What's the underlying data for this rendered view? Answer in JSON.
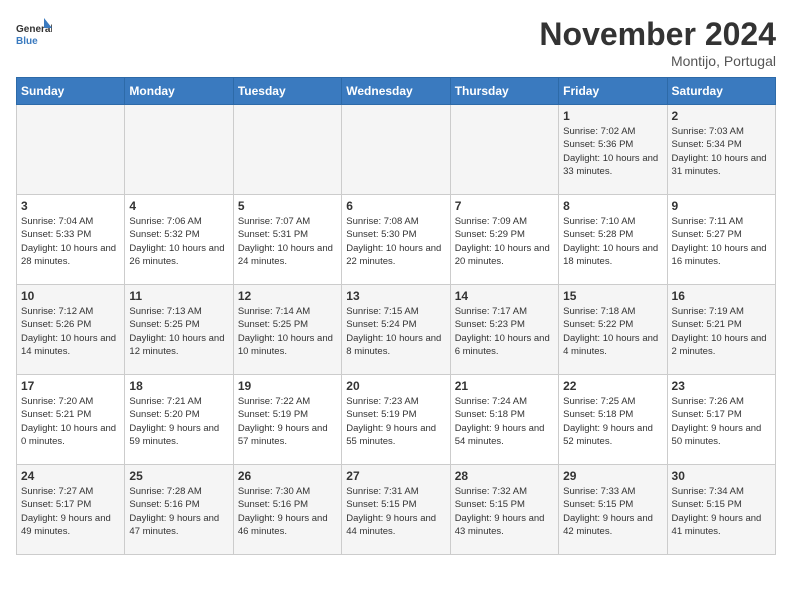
{
  "logo": {
    "line1": "General",
    "line2": "Blue"
  },
  "title": "November 2024",
  "subtitle": "Montijo, Portugal",
  "weekdays": [
    "Sunday",
    "Monday",
    "Tuesday",
    "Wednesday",
    "Thursday",
    "Friday",
    "Saturday"
  ],
  "weeks": [
    [
      {
        "day": "",
        "info": ""
      },
      {
        "day": "",
        "info": ""
      },
      {
        "day": "",
        "info": ""
      },
      {
        "day": "",
        "info": ""
      },
      {
        "day": "",
        "info": ""
      },
      {
        "day": "1",
        "info": "Sunrise: 7:02 AM\nSunset: 5:36 PM\nDaylight: 10 hours\nand 33 minutes."
      },
      {
        "day": "2",
        "info": "Sunrise: 7:03 AM\nSunset: 5:34 PM\nDaylight: 10 hours\nand 31 minutes."
      }
    ],
    [
      {
        "day": "3",
        "info": "Sunrise: 7:04 AM\nSunset: 5:33 PM\nDaylight: 10 hours\nand 28 minutes."
      },
      {
        "day": "4",
        "info": "Sunrise: 7:06 AM\nSunset: 5:32 PM\nDaylight: 10 hours\nand 26 minutes."
      },
      {
        "day": "5",
        "info": "Sunrise: 7:07 AM\nSunset: 5:31 PM\nDaylight: 10 hours\nand 24 minutes."
      },
      {
        "day": "6",
        "info": "Sunrise: 7:08 AM\nSunset: 5:30 PM\nDaylight: 10 hours\nand 22 minutes."
      },
      {
        "day": "7",
        "info": "Sunrise: 7:09 AM\nSunset: 5:29 PM\nDaylight: 10 hours\nand 20 minutes."
      },
      {
        "day": "8",
        "info": "Sunrise: 7:10 AM\nSunset: 5:28 PM\nDaylight: 10 hours\nand 18 minutes."
      },
      {
        "day": "9",
        "info": "Sunrise: 7:11 AM\nSunset: 5:27 PM\nDaylight: 10 hours\nand 16 minutes."
      }
    ],
    [
      {
        "day": "10",
        "info": "Sunrise: 7:12 AM\nSunset: 5:26 PM\nDaylight: 10 hours\nand 14 minutes."
      },
      {
        "day": "11",
        "info": "Sunrise: 7:13 AM\nSunset: 5:25 PM\nDaylight: 10 hours\nand 12 minutes."
      },
      {
        "day": "12",
        "info": "Sunrise: 7:14 AM\nSunset: 5:25 PM\nDaylight: 10 hours\nand 10 minutes."
      },
      {
        "day": "13",
        "info": "Sunrise: 7:15 AM\nSunset: 5:24 PM\nDaylight: 10 hours\nand 8 minutes."
      },
      {
        "day": "14",
        "info": "Sunrise: 7:17 AM\nSunset: 5:23 PM\nDaylight: 10 hours\nand 6 minutes."
      },
      {
        "day": "15",
        "info": "Sunrise: 7:18 AM\nSunset: 5:22 PM\nDaylight: 10 hours\nand 4 minutes."
      },
      {
        "day": "16",
        "info": "Sunrise: 7:19 AM\nSunset: 5:21 PM\nDaylight: 10 hours\nand 2 minutes."
      }
    ],
    [
      {
        "day": "17",
        "info": "Sunrise: 7:20 AM\nSunset: 5:21 PM\nDaylight: 10 hours\nand 0 minutes."
      },
      {
        "day": "18",
        "info": "Sunrise: 7:21 AM\nSunset: 5:20 PM\nDaylight: 9 hours\nand 59 minutes."
      },
      {
        "day": "19",
        "info": "Sunrise: 7:22 AM\nSunset: 5:19 PM\nDaylight: 9 hours\nand 57 minutes."
      },
      {
        "day": "20",
        "info": "Sunrise: 7:23 AM\nSunset: 5:19 PM\nDaylight: 9 hours\nand 55 minutes."
      },
      {
        "day": "21",
        "info": "Sunrise: 7:24 AM\nSunset: 5:18 PM\nDaylight: 9 hours\nand 54 minutes."
      },
      {
        "day": "22",
        "info": "Sunrise: 7:25 AM\nSunset: 5:18 PM\nDaylight: 9 hours\nand 52 minutes."
      },
      {
        "day": "23",
        "info": "Sunrise: 7:26 AM\nSunset: 5:17 PM\nDaylight: 9 hours\nand 50 minutes."
      }
    ],
    [
      {
        "day": "24",
        "info": "Sunrise: 7:27 AM\nSunset: 5:17 PM\nDaylight: 9 hours\nand 49 minutes."
      },
      {
        "day": "25",
        "info": "Sunrise: 7:28 AM\nSunset: 5:16 PM\nDaylight: 9 hours\nand 47 minutes."
      },
      {
        "day": "26",
        "info": "Sunrise: 7:30 AM\nSunset: 5:16 PM\nDaylight: 9 hours\nand 46 minutes."
      },
      {
        "day": "27",
        "info": "Sunrise: 7:31 AM\nSunset: 5:15 PM\nDaylight: 9 hours\nand 44 minutes."
      },
      {
        "day": "28",
        "info": "Sunrise: 7:32 AM\nSunset: 5:15 PM\nDaylight: 9 hours\nand 43 minutes."
      },
      {
        "day": "29",
        "info": "Sunrise: 7:33 AM\nSunset: 5:15 PM\nDaylight: 9 hours\nand 42 minutes."
      },
      {
        "day": "30",
        "info": "Sunrise: 7:34 AM\nSunset: 5:15 PM\nDaylight: 9 hours\nand 41 minutes."
      }
    ]
  ]
}
